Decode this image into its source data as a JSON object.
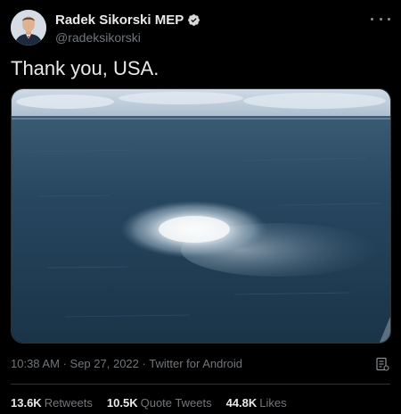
{
  "author": {
    "display_name": "Radek Sikorski MEP",
    "handle": "@radeksikorski",
    "verified": true
  },
  "tweet": {
    "text": "Thank you, USA.",
    "time": "10:38 AM",
    "date": "Sep 27, 2022",
    "source": "Twitter for Android",
    "separator": "·"
  },
  "stats": {
    "retweets_count": "13.6K",
    "retweets_label": "Retweets",
    "quote_count": "10.5K",
    "quote_label": "Quote Tweets",
    "likes_count": "44.8K",
    "likes_label": "Likes"
  },
  "icons": {
    "verified": "verified-badge-icon",
    "more": "more-options-icon",
    "analytics": "analytics-icon"
  },
  "colors": {
    "background": "#000000",
    "text": "#e7e9ea",
    "secondary_text": "#71767b",
    "divider": "#2f3336",
    "verified": "#d9d9d9"
  }
}
